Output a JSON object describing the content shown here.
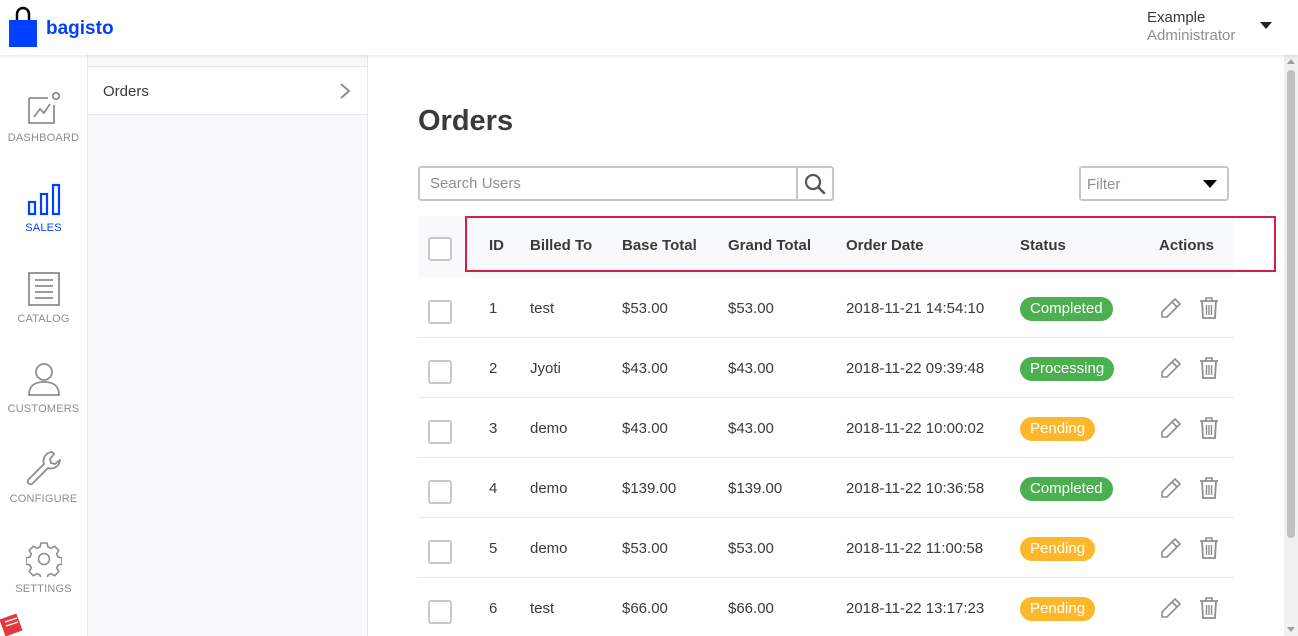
{
  "app": {
    "brand": "bagisto",
    "accent": "#0041ff"
  },
  "header": {
    "user_name": "Example",
    "user_role": "Administrator"
  },
  "nav": {
    "items": [
      {
        "label": "DASHBOARD",
        "icon": "dashboard-icon"
      },
      {
        "label": "SALES",
        "icon": "sales-bar-chart-icon",
        "active": true
      },
      {
        "label": "CATALOG",
        "icon": "catalog-icon"
      },
      {
        "label": "CUSTOMERS",
        "icon": "customer-icon"
      },
      {
        "label": "CONFIGURE",
        "icon": "wrench-icon"
      },
      {
        "label": "SETTINGS",
        "icon": "gear-icon"
      }
    ]
  },
  "subnav": {
    "items": [
      {
        "label": "Orders"
      }
    ]
  },
  "main": {
    "title": "Orders",
    "search": {
      "placeholder": "Search Users"
    },
    "filter": {
      "label": "Filter"
    },
    "table": {
      "columns": [
        "ID",
        "Billed To",
        "Base Total",
        "Grand Total",
        "Order Date",
        "Status",
        "Actions"
      ],
      "rows": [
        {
          "id": "1",
          "billed_to": "test",
          "base_total": "$53.00",
          "grand_total": "$53.00",
          "order_date": "2018-11-21 14:54:10",
          "status": "Completed",
          "status_color": "#4caf50"
        },
        {
          "id": "2",
          "billed_to": "Jyoti",
          "base_total": "$43.00",
          "grand_total": "$43.00",
          "order_date": "2018-11-22 09:39:48",
          "status": "Processing",
          "status_color": "#4caf50"
        },
        {
          "id": "3",
          "billed_to": "demo",
          "base_total": "$43.00",
          "grand_total": "$43.00",
          "order_date": "2018-11-22 10:00:02",
          "status": "Pending",
          "status_color": "#fcb82a"
        },
        {
          "id": "4",
          "billed_to": "demo",
          "base_total": "$139.00",
          "grand_total": "$139.00",
          "order_date": "2018-11-22 10:36:58",
          "status": "Completed",
          "status_color": "#4caf50"
        },
        {
          "id": "5",
          "billed_to": "demo",
          "base_total": "$53.00",
          "grand_total": "$53.00",
          "order_date": "2018-11-22 11:00:58",
          "status": "Pending",
          "status_color": "#fcb82a"
        },
        {
          "id": "6",
          "billed_to": "test",
          "base_total": "$66.00",
          "grand_total": "$66.00",
          "order_date": "2018-11-22 13:17:23",
          "status": "Pending",
          "status_color": "#fcb82a"
        }
      ]
    }
  },
  "colors": {
    "highlight_border": "#d0204a",
    "completed": "#4caf50",
    "pending": "#fcb82a"
  }
}
